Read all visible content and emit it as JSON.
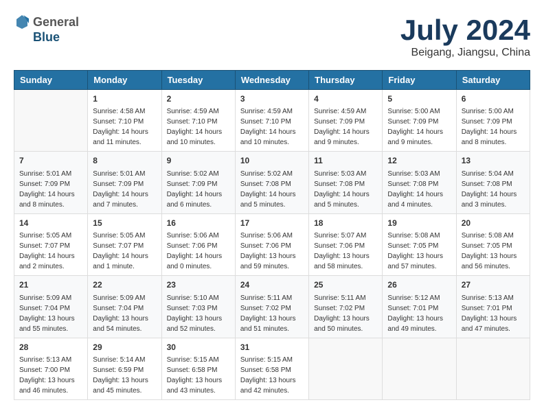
{
  "header": {
    "logo_general": "General",
    "logo_blue": "Blue",
    "title": "July 2024",
    "subtitle": "Beigang, Jiangsu, China"
  },
  "calendar": {
    "days_of_week": [
      "Sunday",
      "Monday",
      "Tuesday",
      "Wednesday",
      "Thursday",
      "Friday",
      "Saturday"
    ],
    "weeks": [
      [
        {
          "day": "",
          "info": ""
        },
        {
          "day": "1",
          "info": "Sunrise: 4:58 AM\nSunset: 7:10 PM\nDaylight: 14 hours\nand 11 minutes."
        },
        {
          "day": "2",
          "info": "Sunrise: 4:59 AM\nSunset: 7:10 PM\nDaylight: 14 hours\nand 10 minutes."
        },
        {
          "day": "3",
          "info": "Sunrise: 4:59 AM\nSunset: 7:10 PM\nDaylight: 14 hours\nand 10 minutes."
        },
        {
          "day": "4",
          "info": "Sunrise: 4:59 AM\nSunset: 7:09 PM\nDaylight: 14 hours\nand 9 minutes."
        },
        {
          "day": "5",
          "info": "Sunrise: 5:00 AM\nSunset: 7:09 PM\nDaylight: 14 hours\nand 9 minutes."
        },
        {
          "day": "6",
          "info": "Sunrise: 5:00 AM\nSunset: 7:09 PM\nDaylight: 14 hours\nand 8 minutes."
        }
      ],
      [
        {
          "day": "7",
          "info": "Sunrise: 5:01 AM\nSunset: 7:09 PM\nDaylight: 14 hours\nand 8 minutes."
        },
        {
          "day": "8",
          "info": "Sunrise: 5:01 AM\nSunset: 7:09 PM\nDaylight: 14 hours\nand 7 minutes."
        },
        {
          "day": "9",
          "info": "Sunrise: 5:02 AM\nSunset: 7:09 PM\nDaylight: 14 hours\nand 6 minutes."
        },
        {
          "day": "10",
          "info": "Sunrise: 5:02 AM\nSunset: 7:08 PM\nDaylight: 14 hours\nand 5 minutes."
        },
        {
          "day": "11",
          "info": "Sunrise: 5:03 AM\nSunset: 7:08 PM\nDaylight: 14 hours\nand 5 minutes."
        },
        {
          "day": "12",
          "info": "Sunrise: 5:03 AM\nSunset: 7:08 PM\nDaylight: 14 hours\nand 4 minutes."
        },
        {
          "day": "13",
          "info": "Sunrise: 5:04 AM\nSunset: 7:08 PM\nDaylight: 14 hours\nand 3 minutes."
        }
      ],
      [
        {
          "day": "14",
          "info": "Sunrise: 5:05 AM\nSunset: 7:07 PM\nDaylight: 14 hours\nand 2 minutes."
        },
        {
          "day": "15",
          "info": "Sunrise: 5:05 AM\nSunset: 7:07 PM\nDaylight: 14 hours\nand 1 minute."
        },
        {
          "day": "16",
          "info": "Sunrise: 5:06 AM\nSunset: 7:06 PM\nDaylight: 14 hours\nand 0 minutes."
        },
        {
          "day": "17",
          "info": "Sunrise: 5:06 AM\nSunset: 7:06 PM\nDaylight: 13 hours\nand 59 minutes."
        },
        {
          "day": "18",
          "info": "Sunrise: 5:07 AM\nSunset: 7:06 PM\nDaylight: 13 hours\nand 58 minutes."
        },
        {
          "day": "19",
          "info": "Sunrise: 5:08 AM\nSunset: 7:05 PM\nDaylight: 13 hours\nand 57 minutes."
        },
        {
          "day": "20",
          "info": "Sunrise: 5:08 AM\nSunset: 7:05 PM\nDaylight: 13 hours\nand 56 minutes."
        }
      ],
      [
        {
          "day": "21",
          "info": "Sunrise: 5:09 AM\nSunset: 7:04 PM\nDaylight: 13 hours\nand 55 minutes."
        },
        {
          "day": "22",
          "info": "Sunrise: 5:09 AM\nSunset: 7:04 PM\nDaylight: 13 hours\nand 54 minutes."
        },
        {
          "day": "23",
          "info": "Sunrise: 5:10 AM\nSunset: 7:03 PM\nDaylight: 13 hours\nand 52 minutes."
        },
        {
          "day": "24",
          "info": "Sunrise: 5:11 AM\nSunset: 7:02 PM\nDaylight: 13 hours\nand 51 minutes."
        },
        {
          "day": "25",
          "info": "Sunrise: 5:11 AM\nSunset: 7:02 PM\nDaylight: 13 hours\nand 50 minutes."
        },
        {
          "day": "26",
          "info": "Sunrise: 5:12 AM\nSunset: 7:01 PM\nDaylight: 13 hours\nand 49 minutes."
        },
        {
          "day": "27",
          "info": "Sunrise: 5:13 AM\nSunset: 7:01 PM\nDaylight: 13 hours\nand 47 minutes."
        }
      ],
      [
        {
          "day": "28",
          "info": "Sunrise: 5:13 AM\nSunset: 7:00 PM\nDaylight: 13 hours\nand 46 minutes."
        },
        {
          "day": "29",
          "info": "Sunrise: 5:14 AM\nSunset: 6:59 PM\nDaylight: 13 hours\nand 45 minutes."
        },
        {
          "day": "30",
          "info": "Sunrise: 5:15 AM\nSunset: 6:58 PM\nDaylight: 13 hours\nand 43 minutes."
        },
        {
          "day": "31",
          "info": "Sunrise: 5:15 AM\nSunset: 6:58 PM\nDaylight: 13 hours\nand 42 minutes."
        },
        {
          "day": "",
          "info": ""
        },
        {
          "day": "",
          "info": ""
        },
        {
          "day": "",
          "info": ""
        }
      ]
    ]
  }
}
